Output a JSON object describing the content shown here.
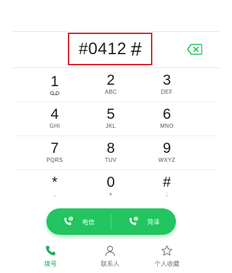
{
  "display": {
    "number": "#0412",
    "trailing_char": "#"
  },
  "keypad": {
    "rows": [
      [
        {
          "digit": "1",
          "letters": ""
        },
        {
          "digit": "2",
          "letters": "ABC"
        },
        {
          "digit": "3",
          "letters": "DEF"
        }
      ],
      [
        {
          "digit": "4",
          "letters": "GHI"
        },
        {
          "digit": "5",
          "letters": "JKL"
        },
        {
          "digit": "6",
          "letters": "MNO"
        }
      ],
      [
        {
          "digit": "7",
          "letters": "PQRS"
        },
        {
          "digit": "8",
          "letters": "TUV"
        },
        {
          "digit": "9",
          "letters": "WXYZ"
        }
      ],
      [
        {
          "digit": "*",
          "letters": ","
        },
        {
          "digit": "0",
          "letters": "+"
        },
        {
          "digit": "#",
          "letters": ";"
        }
      ]
    ]
  },
  "call": {
    "sim1_label": "电信",
    "sim2_label": "菏泽",
    "sim1_badge": "1",
    "sim2_badge": "2",
    "color": "#22c55f"
  },
  "tabs": [
    {
      "label": "拨号",
      "icon": "phone-icon",
      "active": true
    },
    {
      "label": "联系人",
      "icon": "person-icon",
      "active": false
    },
    {
      "label": "个人收藏",
      "icon": "star-icon",
      "active": false
    }
  ],
  "colors": {
    "accent": "#22c55f",
    "highlight_box": "#d9232e"
  }
}
